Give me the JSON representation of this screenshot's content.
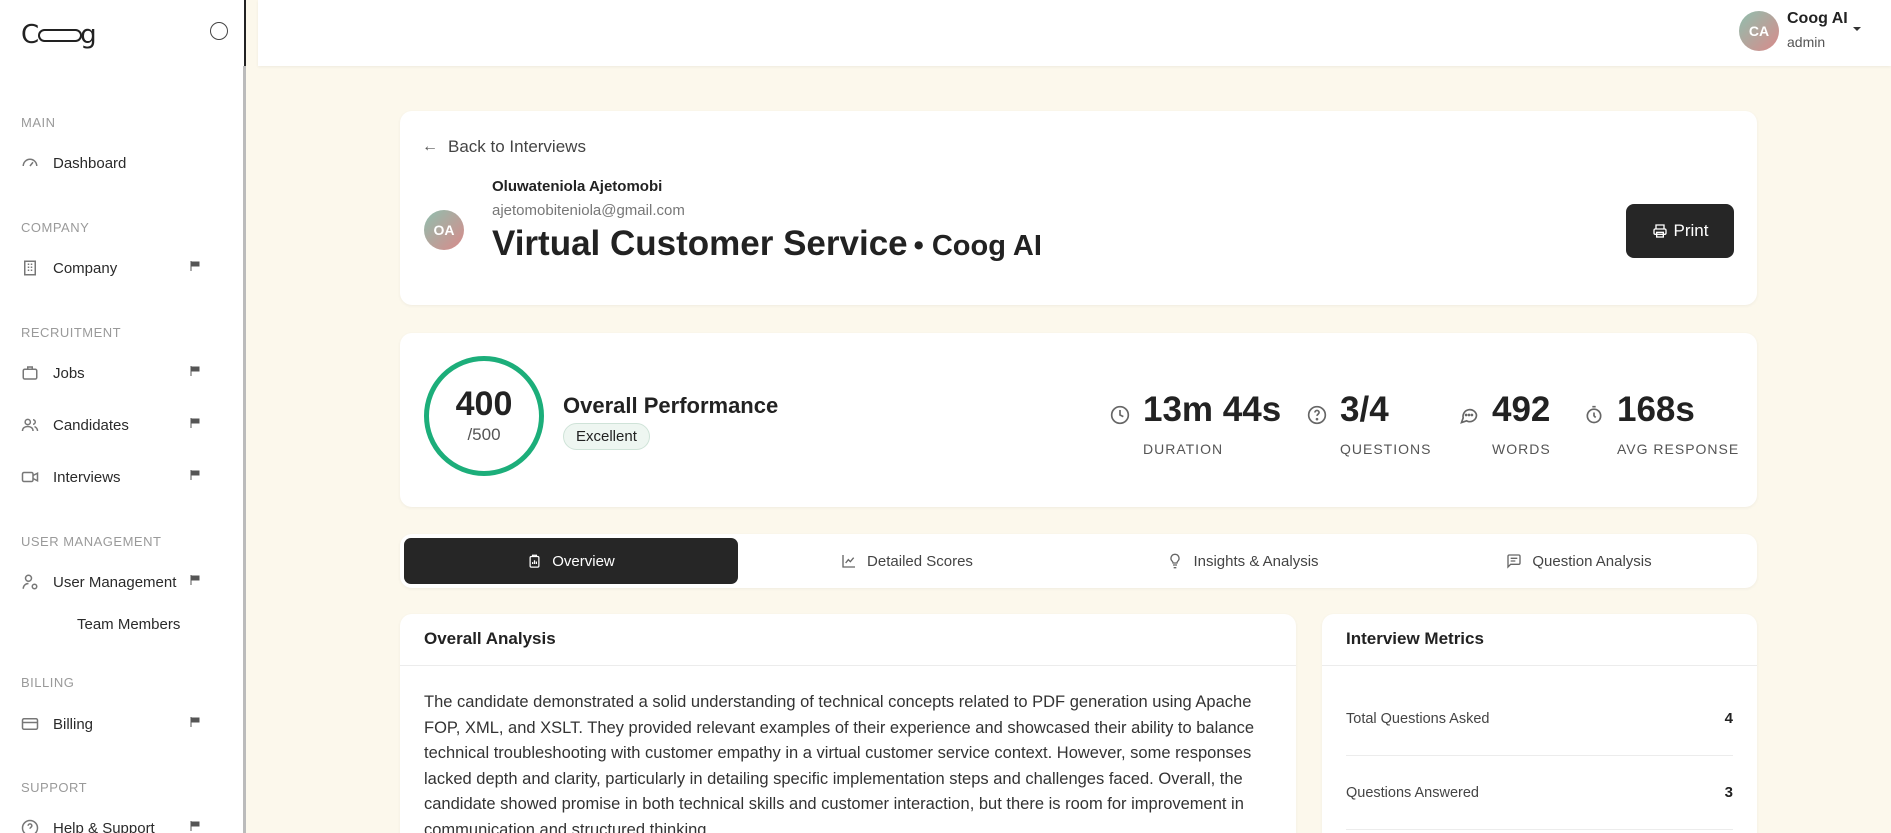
{
  "app": {
    "logo_text_left": "C",
    "logo_text_right": "g"
  },
  "sidebar": {
    "sections": {
      "main": "MAIN",
      "company": "COMPANY",
      "recruitment": "RECRUITMENT",
      "user_management": "USER MANAGEMENT",
      "billing": "BILLING",
      "support": "SUPPORT"
    },
    "items": {
      "dashboard": "Dashboard",
      "company": "Company",
      "jobs": "Jobs",
      "candidates": "Candidates",
      "interviews": "Interviews",
      "user_management": "User Management",
      "team_members": "Team Members",
      "billing": "Billing",
      "help_support": "Help & Support"
    }
  },
  "topbar": {
    "avatar_initials": "CA",
    "user_name": "Coog AI",
    "user_role": "admin"
  },
  "header": {
    "back_label": "Back to Interviews",
    "candidate_initials": "OA",
    "candidate_name": "Oluwateniola Ajetomobi",
    "candidate_email": "ajetomobiteniola@gmail.com",
    "job_title": "Virtual Customer Service",
    "company": "• Coog AI",
    "print_label": "Print"
  },
  "performance": {
    "score": "400",
    "score_max": "/500",
    "title": "Overall Performance",
    "badge": "Excellent",
    "metrics": [
      {
        "value": "13m 44s",
        "label": "DURATION",
        "icon": "clock-icon"
      },
      {
        "value": "3/4",
        "label": "QUESTIONS",
        "icon": "question-icon"
      },
      {
        "value": "492",
        "label": "WORDS",
        "icon": "chat-icon"
      },
      {
        "value": "168s",
        "label": "AVG RESPONSE",
        "icon": "timer-icon"
      }
    ]
  },
  "tabs": [
    {
      "label": "Overview",
      "active": true
    },
    {
      "label": "Detailed Scores",
      "active": false
    },
    {
      "label": "Insights & Analysis",
      "active": false
    },
    {
      "label": "Question Analysis",
      "active": false
    }
  ],
  "analysis": {
    "title": "Overall Analysis",
    "text": "The candidate demonstrated a solid understanding of technical concepts related to PDF generation using Apache FOP, XML, and XSLT. They provided relevant examples of their experience and showcased their ability to balance technical troubleshooting with customer empathy in a virtual customer service context. However, some responses lacked depth and clarity, particularly in detailing specific implementation steps and challenges faced. Overall, the candidate showed promise in both technical skills and customer interaction, but there is room for improvement in communication and structured thinking."
  },
  "interview_metrics": {
    "title": "Interview Metrics",
    "rows": [
      {
        "label": "Total Questions Asked",
        "value": "4"
      },
      {
        "label": "Questions Answered",
        "value": "3"
      }
    ]
  }
}
